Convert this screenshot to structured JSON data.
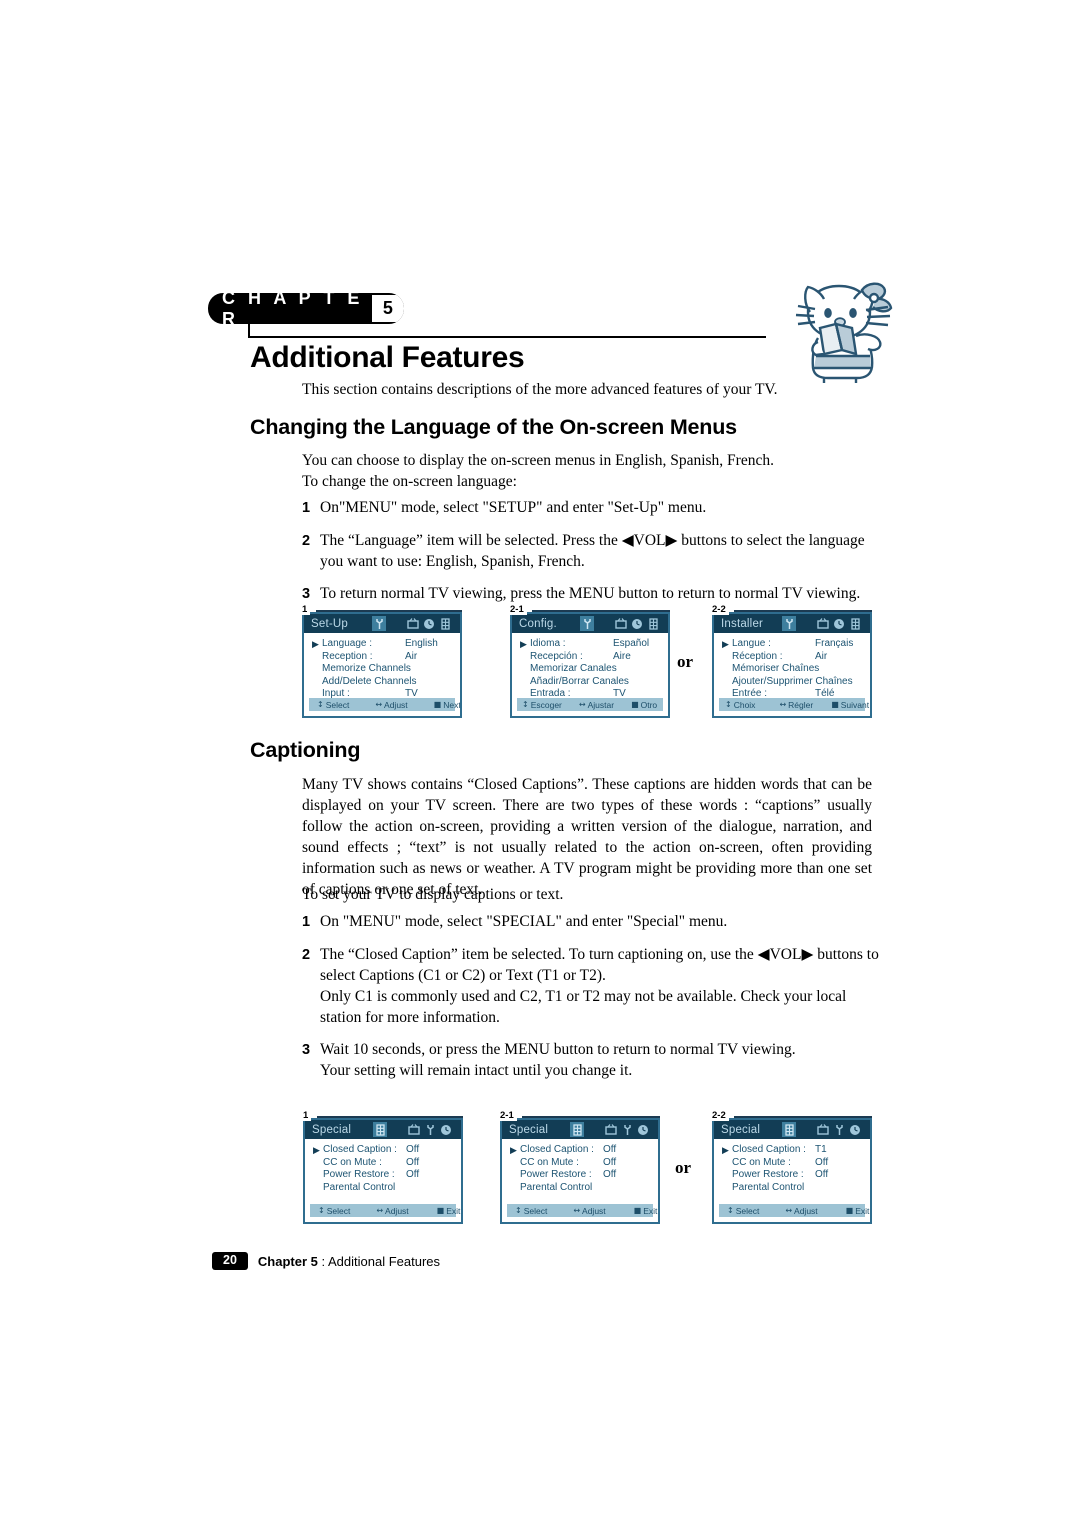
{
  "chapter": {
    "word": "C H A P T E R",
    "number": "5"
  },
  "page_title": "Additional Features",
  "intro": "This section contains descriptions of the more advanced features of your TV.",
  "mascot_name": "hello-kitty-mascot",
  "sections": [
    {
      "heading": "Changing the Language of the On-screen Menus",
      "paragraph": "You can choose to display the on-screen menus in English, Spanish, French.\nTo change the on-screen language:",
      "steps": [
        {
          "num": "1",
          "text": "On\"MENU\" mode, select \"SETUP\" and enter \"Set-Up\" menu."
        },
        {
          "num": "2",
          "text": "The “Language” item will be selected. Press the ◀VOL▶ buttons to select the language you want to use: English, Spanish, French."
        },
        {
          "num": "3",
          "text": "To return normal TV viewing, press the MENU button to return to normal TV viewing."
        }
      ]
    },
    {
      "heading": "Captioning",
      "paragraph": "Many TV shows contains “Closed Captions”. These captions are hidden words that can be displayed on your TV screen. There are two types of these words : “captions” usually follow the action on-screen, providing a written version of the dialogue, narration, and sound effects ; “text” is not usually related to the action on-screen, often providing information such as news or weather. A TV program might be providing more than one set of captions or one set of text.",
      "lead": "To set your TV to display captions or text.",
      "steps": [
        {
          "num": "1",
          "text": "On \"MENU\" mode, select \"SPECIAL\" and enter \"Special\" menu."
        },
        {
          "num": "2",
          "text": "The “Closed Caption” item be selected. To turn captioning on, use the ◀VOL▶ buttons to select Captions (C1 or C2) or Text (T1 or T2).",
          "sub": "Only C1 is commonly used and C2, T1 or T2 may not be available. Check your local station for more information."
        },
        {
          "num": "3",
          "text": "Wait 10 seconds, or press the MENU button to return to normal TV viewing.",
          "sub": "Your setting will remain intact until you change it."
        }
      ]
    }
  ],
  "osd_setup_group": {
    "or_label": "or",
    "panels": [
      {
        "tag": "1",
        "title": "Set-Up",
        "selected_icon": "wrench-icon",
        "icons": [
          "tv-icon",
          "clock-icon",
          "grid-icon"
        ],
        "rows": [
          {
            "cursor": "▶",
            "label": "Language :",
            "value": "English"
          },
          {
            "cursor": "",
            "label": "Reception :",
            "value": "Air"
          },
          {
            "cursor": "",
            "label": "Memorize Channels",
            "value": ""
          },
          {
            "cursor": "",
            "label": "Add/Delete Channels",
            "value": ""
          },
          {
            "cursor": "",
            "label": "Input :",
            "value": "TV"
          }
        ],
        "footer": [
          {
            "glyph": "↕",
            "label": "Select"
          },
          {
            "glyph": "↔",
            "label": "Adjust"
          },
          {
            "glyph": "■",
            "label": "Next"
          }
        ]
      },
      {
        "tag": "2-1",
        "title": "Config.",
        "selected_icon": "wrench-icon",
        "icons": [
          "tv-icon",
          "clock-icon",
          "grid-icon"
        ],
        "rows": [
          {
            "cursor": "▶",
            "label": "Idioma :",
            "value": "Español"
          },
          {
            "cursor": "",
            "label": "Recepción :",
            "value": "Aire"
          },
          {
            "cursor": "",
            "label": "Memorizar Canales",
            "value": ""
          },
          {
            "cursor": "",
            "label": "Añadir/Borrar Canales",
            "value": ""
          },
          {
            "cursor": "",
            "label": "Entrada :",
            "value": "TV"
          }
        ],
        "footer": [
          {
            "glyph": "↕",
            "label": "Escoger"
          },
          {
            "glyph": "↔",
            "label": "Ajustar"
          },
          {
            "glyph": "■",
            "label": "Otro"
          }
        ]
      },
      {
        "tag": "2-2",
        "title": "Installer",
        "selected_icon": "wrench-icon",
        "icons": [
          "tv-icon",
          "clock-icon",
          "grid-icon"
        ],
        "rows": [
          {
            "cursor": "▶",
            "label": "Langue :",
            "value": "Français"
          },
          {
            "cursor": "",
            "label": "Réception :",
            "value": "Air"
          },
          {
            "cursor": "",
            "label": "Mémoriser Chaînes",
            "value": ""
          },
          {
            "cursor": "",
            "label": "Ajouter/Supprimer Chaînes",
            "value": ""
          },
          {
            "cursor": "",
            "label": "Entrée :",
            "value": "Télé"
          }
        ],
        "footer": [
          {
            "glyph": "↕",
            "label": "Choix"
          },
          {
            "glyph": "↔",
            "label": "Régler"
          },
          {
            "glyph": "■",
            "label": "Suivant"
          }
        ]
      }
    ]
  },
  "osd_special_group": {
    "or_label": "or",
    "panels": [
      {
        "tag": "1",
        "title": "Special",
        "selected_icon": "grid-icon",
        "icons": [
          "tv-icon",
          "wrench-icon",
          "clock-icon"
        ],
        "rows": [
          {
            "cursor": "▶",
            "label": "Closed Caption :",
            "value": "Off"
          },
          {
            "cursor": "",
            "label": "CC on Mute :",
            "value": "Off"
          },
          {
            "cursor": "",
            "label": "Power Restore :",
            "value": "Off"
          },
          {
            "cursor": "",
            "label": "Parental Control",
            "value": ""
          }
        ],
        "footer": [
          {
            "glyph": "↕",
            "label": "Select"
          },
          {
            "glyph": "↔",
            "label": "Adjust"
          },
          {
            "glyph": "■",
            "label": "Exit"
          }
        ]
      },
      {
        "tag": "2-1",
        "title": "Special",
        "selected_icon": "grid-icon",
        "icons": [
          "tv-icon",
          "wrench-icon",
          "clock-icon"
        ],
        "rows": [
          {
            "cursor": "▶",
            "label": "Closed Caption :",
            "value": "Off"
          },
          {
            "cursor": "",
            "label": "CC on Mute :",
            "value": "Off"
          },
          {
            "cursor": "",
            "label": "Power Restore :",
            "value": "Off"
          },
          {
            "cursor": "",
            "label": "Parental Control",
            "value": ""
          }
        ],
        "footer": [
          {
            "glyph": "↕",
            "label": "Select"
          },
          {
            "glyph": "↔",
            "label": "Adjust"
          },
          {
            "glyph": "■",
            "label": "Exit"
          }
        ]
      },
      {
        "tag": "2-2",
        "title": "Special",
        "selected_icon": "grid-icon",
        "icons": [
          "tv-icon",
          "wrench-icon",
          "clock-icon"
        ],
        "rows": [
          {
            "cursor": "▶",
            "label": "Closed Caption :",
            "value": "T1"
          },
          {
            "cursor": "",
            "label": "CC on Mute :",
            "value": "Off"
          },
          {
            "cursor": "",
            "label": "Power Restore :",
            "value": "Off"
          },
          {
            "cursor": "",
            "label": "Parental Control",
            "value": ""
          }
        ],
        "footer": [
          {
            "glyph": "↕",
            "label": "Select"
          },
          {
            "glyph": "↔",
            "label": "Adjust"
          },
          {
            "glyph": "■",
            "label": "Exit"
          }
        ]
      }
    ]
  },
  "footer": {
    "page_number": "20",
    "chapter_label": "Chapter 5",
    "separator": " : ",
    "title": "Additional Features"
  },
  "colors": {
    "osd_header_bg": "#123d55",
    "osd_border": "#2f6d8f",
    "osd_title_text": "#bcd9e8",
    "osd_body_text": "#1d5472",
    "osd_footer_bg": "#9dc3d4",
    "osd_icon_selected_bg": "#3e7f9e"
  }
}
